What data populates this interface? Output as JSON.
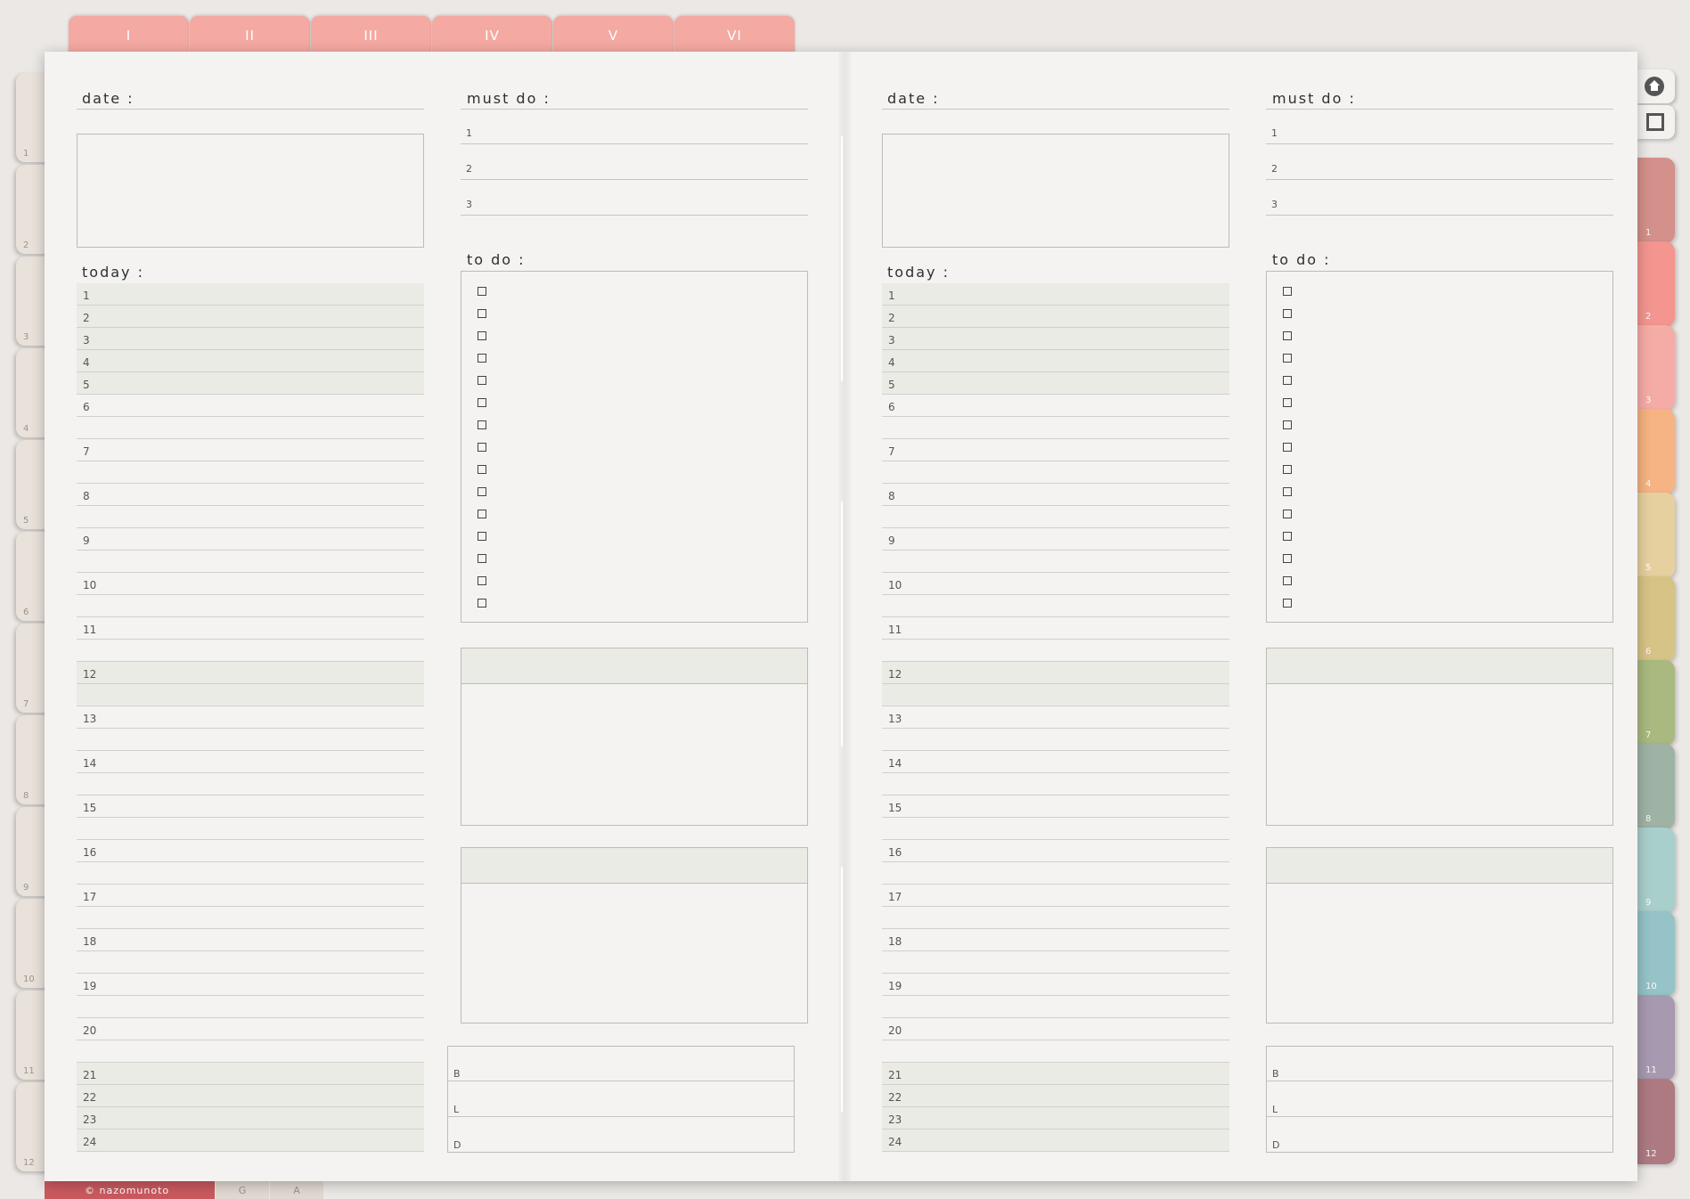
{
  "top_tabs": [
    "I",
    "II",
    "III",
    "IV",
    "V",
    "VI"
  ],
  "left_tabs": [
    "1",
    "2",
    "3",
    "4",
    "5",
    "6",
    "7",
    "8",
    "9",
    "10",
    "11",
    "12"
  ],
  "right_tabs": [
    {
      "label": "1",
      "color": "#d4908a"
    },
    {
      "label": "2",
      "color": "#f4958f"
    },
    {
      "label": "3",
      "color": "#f6aca6"
    },
    {
      "label": "4",
      "color": "#f6b383"
    },
    {
      "label": "5",
      "color": "#e7d0a0"
    },
    {
      "label": "6",
      "color": "#d6c386"
    },
    {
      "label": "7",
      "color": "#a9b97f"
    },
    {
      "label": "8",
      "color": "#9fb3a5"
    },
    {
      "label": "9",
      "color": "#a9cfcc"
    },
    {
      "label": "10",
      "color": "#95c3c8"
    },
    {
      "label": "11",
      "color": "#a79ab0"
    },
    {
      "label": "12",
      "color": "#ad7a82"
    }
  ],
  "bottom": {
    "credit": "© nazomunoto",
    "tabs": [
      "G",
      "A"
    ]
  },
  "labels": {
    "date": "date :",
    "must_do": "must do :",
    "today": "today :",
    "to_do": "to do :"
  },
  "must_do_items": [
    "1",
    "2",
    "3"
  ],
  "hours": [
    "1",
    "2",
    "3",
    "4",
    "5",
    "6",
    "7",
    "8",
    "9",
    "10",
    "11",
    "12",
    "13",
    "14",
    "15",
    "16",
    "17",
    "18",
    "19",
    "20",
    "21",
    "22",
    "23",
    "24"
  ],
  "meals": [
    "B",
    "L",
    "D"
  ],
  "todo_count": 15
}
